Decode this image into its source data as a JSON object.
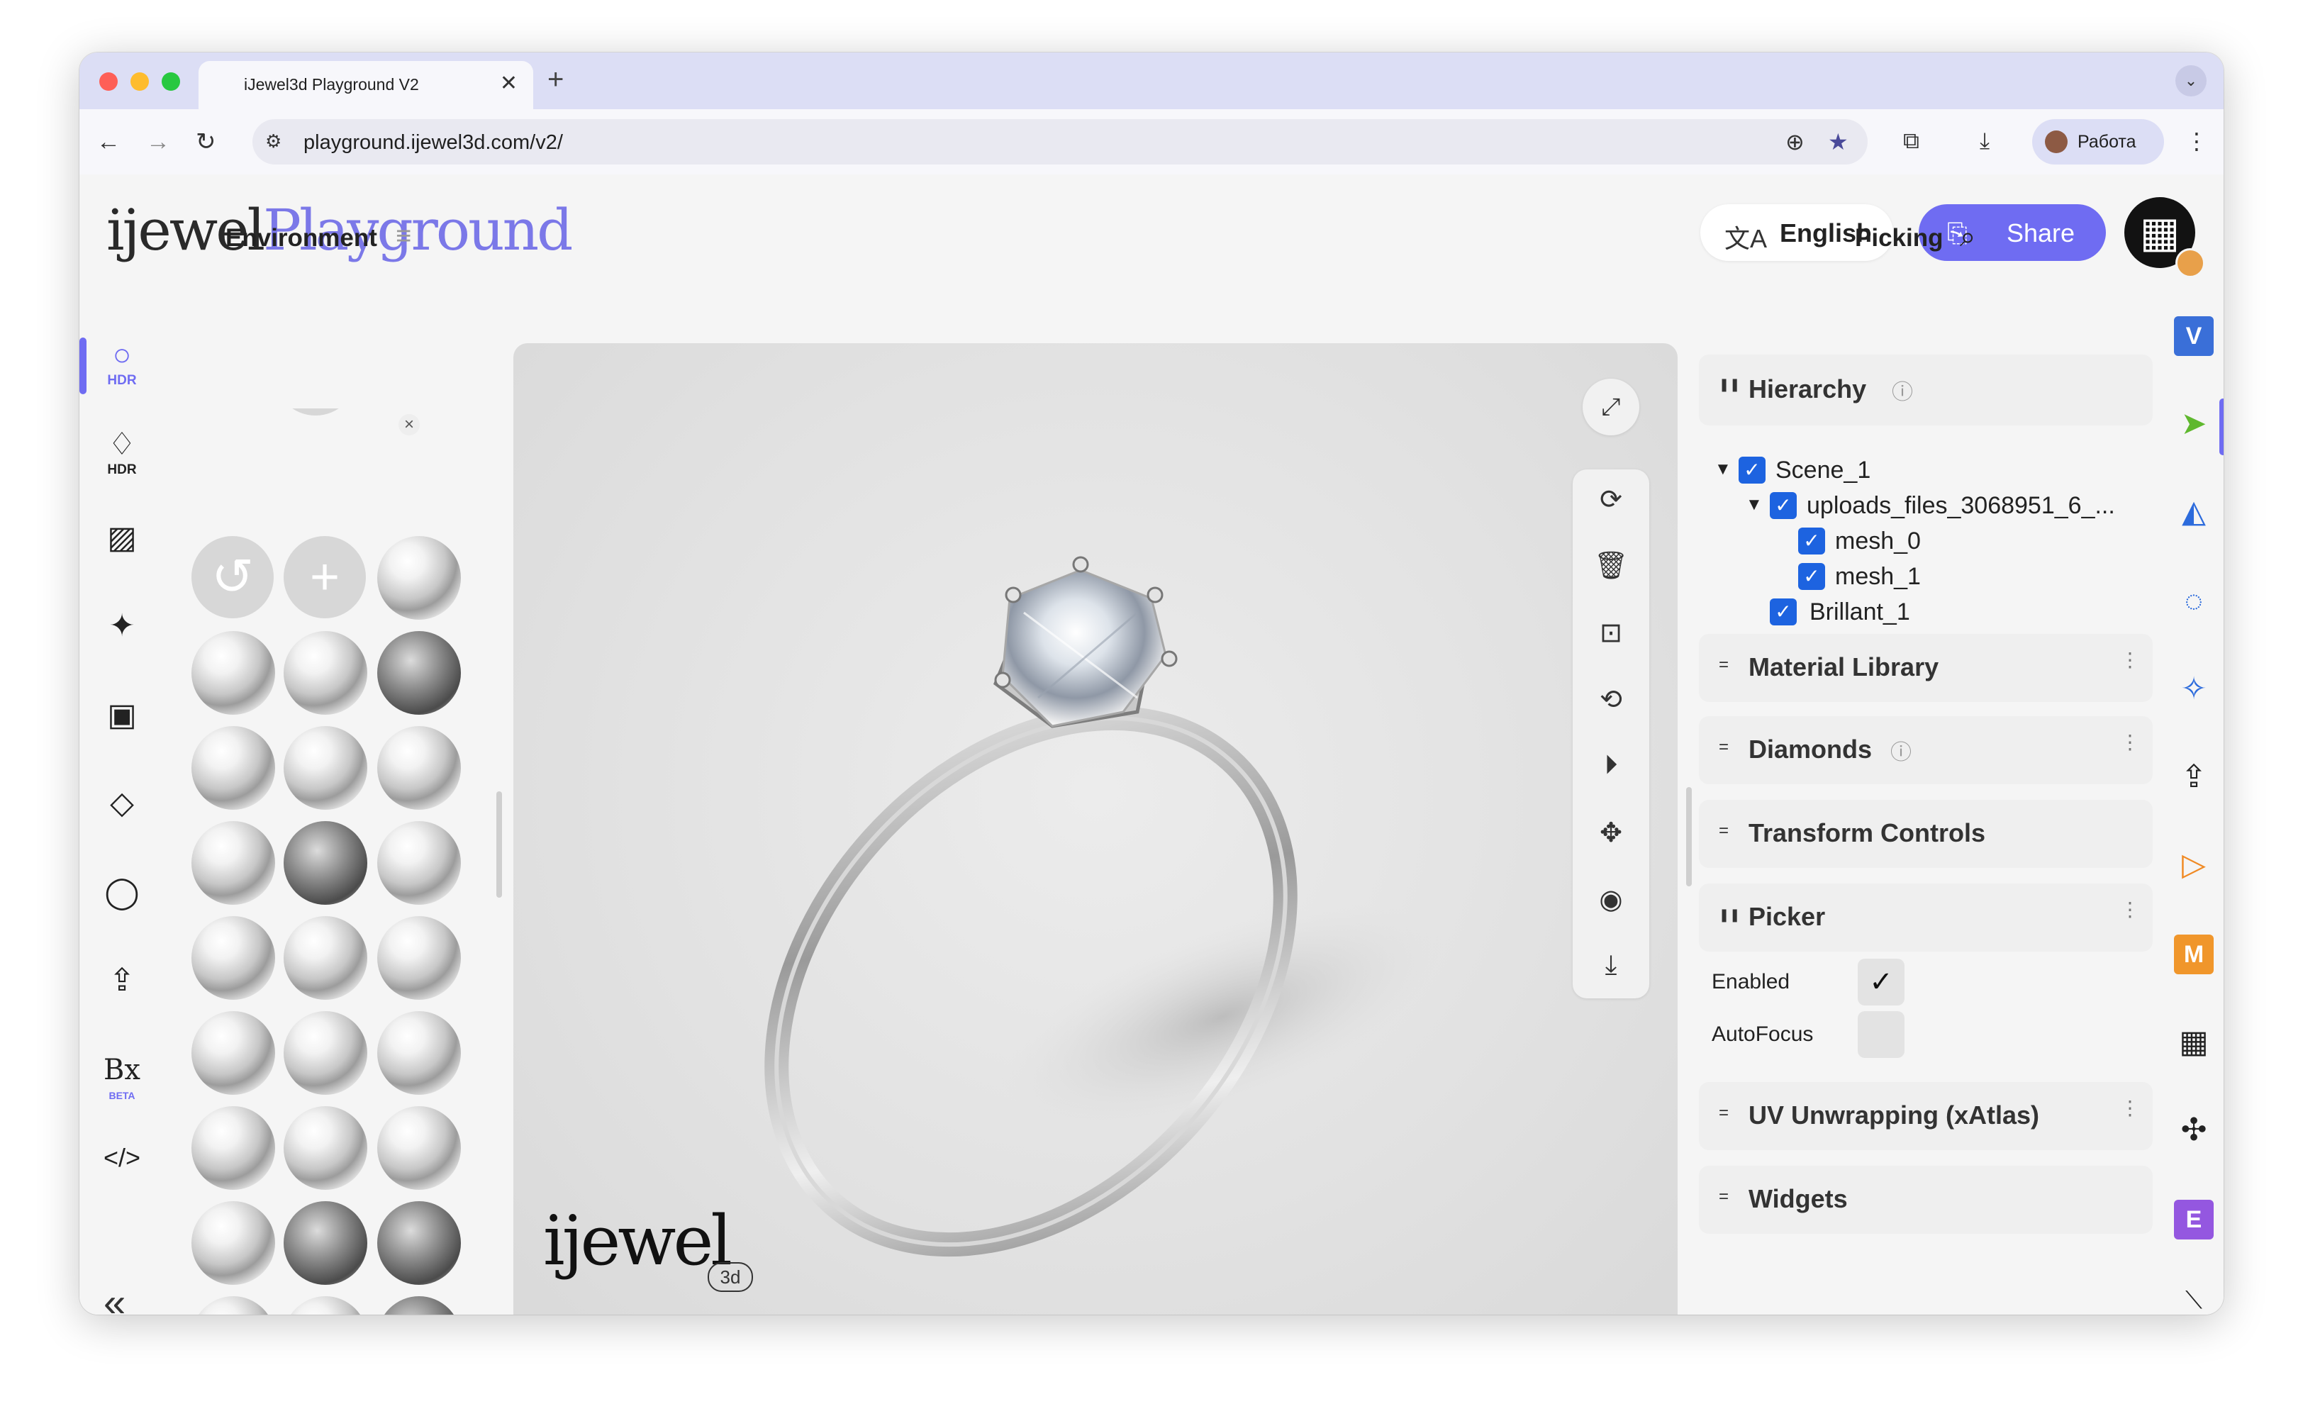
{
  "browser": {
    "tab_title": "iJewel3d Playground V2",
    "tab_close": "✕",
    "new_tab": "+",
    "tab_menu": "⌄",
    "url": "playground.ijewel3d.com/v2/",
    "profile_label": "Работа",
    "nav": {
      "back": "←",
      "forward": "→",
      "reload": "↻",
      "site_info": "⚙",
      "zoom": "⊕",
      "bookmark": "★",
      "extensions": "⧉",
      "downloads": "⤓",
      "menu": "⋮"
    },
    "traffic_colors": [
      "#fe5f57",
      "#febc2e",
      "#28c840"
    ]
  },
  "app": {
    "logo_part1": "ijewel",
    "logo_part2": "Playground",
    "language_label": "English",
    "language_icon": "文A",
    "share_label": "Share",
    "share_icon": "⎘",
    "avatar_glyph": "▦",
    "accent_color": "#6f6cf2"
  },
  "left_nav": [
    {
      "icon": "hdr-ring-icon",
      "glyph": "○",
      "label": "HDR",
      "active": true
    },
    {
      "icon": "hdr-diamond-icon",
      "glyph": "♢",
      "label": "HDR"
    },
    {
      "icon": "hatch-icon",
      "glyph": "▨",
      "label": ""
    },
    {
      "icon": "sparkle-icon",
      "glyph": "✦",
      "label": ""
    },
    {
      "icon": "image-frame-icon",
      "glyph": "▣",
      "label": ""
    },
    {
      "icon": "plane-icon",
      "glyph": "◇",
      "label": ""
    },
    {
      "icon": "ring-icon",
      "glyph": "◯",
      "label": ""
    },
    {
      "icon": "upload-icon",
      "glyph": "⇪",
      "label": ""
    },
    {
      "icon": "bx-beta-icon",
      "glyph": "Bx",
      "label": "BETA"
    },
    {
      "icon": "code-icon",
      "glyph": "</>",
      "label": ""
    }
  ],
  "collapse_glyph": "«",
  "environment": {
    "title": "Environment",
    "title_icon": "≡",
    "reset_glyph": "↺",
    "add_glyph": "+",
    "remove_glyph": "×"
  },
  "viewport": {
    "fullscreen_glyph": "⤢",
    "tools": [
      {
        "icon": "rotate-icon",
        "glyph": "⟳"
      },
      {
        "icon": "trash-icon",
        "glyph": "🗑"
      },
      {
        "icon": "focus-icon",
        "glyph": "⊡"
      },
      {
        "icon": "sync-icon",
        "glyph": "⟲"
      },
      {
        "icon": "play-icon",
        "glyph": "⏵"
      },
      {
        "icon": "move-icon",
        "glyph": "✥"
      },
      {
        "icon": "camera-icon",
        "glyph": "◉"
      },
      {
        "icon": "download-icon",
        "glyph": "⤓"
      }
    ],
    "watermark": "ijewel",
    "watermark_badge": "3d"
  },
  "right_panel": {
    "title": "Picking",
    "title_icon": "⌕",
    "hierarchy": {
      "label": "Hierarchy",
      "info_glyph": "ⓘ",
      "tree": [
        {
          "label": "Scene_1",
          "indent": 0,
          "caret": "▼",
          "checked": true
        },
        {
          "label": "uploads_files_3068951_6_...",
          "indent": 1,
          "caret": "▼",
          "checked": true
        },
        {
          "label": "mesh_0",
          "indent": 2,
          "caret": "",
          "checked": true
        },
        {
          "label": "mesh_1",
          "indent": 2,
          "caret": "",
          "checked": true
        },
        {
          "label": "Brillant_1",
          "indent": 1,
          "caret": "",
          "checked": true
        }
      ]
    },
    "sections": [
      {
        "label": "Material Library",
        "kebab": "⋮"
      },
      {
        "label": "Diamonds",
        "info": "ⓘ",
        "kebab": "⋮"
      },
      {
        "label": "Transform Controls"
      },
      {
        "label": "Picker",
        "kebab": "⋮"
      },
      {
        "label": "UV Unwrapping (xAtlas)",
        "kebab": "⋮"
      },
      {
        "label": "Widgets"
      }
    ],
    "picker": {
      "enabled_label": "Enabled",
      "enabled_value": "✓",
      "autofocus_label": "AutoFocus",
      "autofocus_value": ""
    },
    "grip_glyph": "=",
    "grip_glyph_open": "❚❚"
  },
  "far_right": [
    {
      "icon": "v-badge-icon",
      "glyph": "V",
      "color": "#3a6fd8",
      "badge": true
    },
    {
      "icon": "pointer-icon",
      "glyph": "➤",
      "color": "#5fb82e",
      "active": true
    },
    {
      "icon": "shapes-icon",
      "glyph": "◭",
      "color": "#2c6bdc"
    },
    {
      "icon": "circle-arrow-icon",
      "glyph": "◌",
      "color": "#2c6bdc"
    },
    {
      "icon": "star-icon",
      "glyph": "✧",
      "color": "#2c6bdc"
    },
    {
      "icon": "export-icon",
      "glyph": "⇪",
      "color": "#222"
    },
    {
      "icon": "play-outline-icon",
      "glyph": "▷",
      "color": "#f08a24"
    },
    {
      "icon": "m-badge-icon",
      "glyph": "M",
      "color": "#f0962b",
      "badge": true
    },
    {
      "icon": "grid-icon",
      "glyph": "▦",
      "color": "#222"
    },
    {
      "icon": "puzzle-icon",
      "glyph": "✣",
      "color": "#222"
    },
    {
      "icon": "e-badge-icon",
      "glyph": "E",
      "color": "#9457e0",
      "badge": true
    },
    {
      "icon": "resize-icon",
      "glyph": "⟍",
      "color": "#222"
    }
  ]
}
